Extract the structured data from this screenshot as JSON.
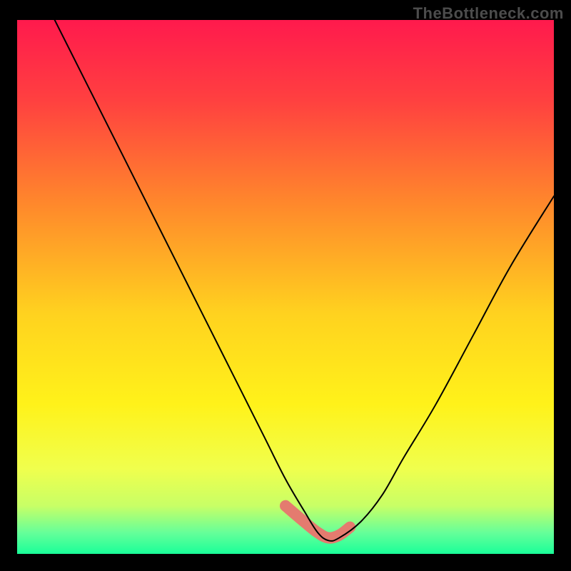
{
  "attribution": "TheBottleneck.com",
  "chart_data": {
    "type": "line",
    "title": "",
    "xlabel": "",
    "ylabel": "",
    "xlim": [
      0,
      100
    ],
    "ylim": [
      0,
      100
    ],
    "series": [
      {
        "name": "bottleneck-curve",
        "x": [
          7,
          10,
          14,
          18,
          22,
          26,
          30,
          34,
          38,
          42,
          46,
          50,
          53.5,
          56,
          58,
          60,
          64,
          68,
          72,
          78,
          85,
          92,
          100
        ],
        "y": [
          100,
          94,
          86,
          78,
          70,
          62,
          54,
          46,
          38,
          30,
          22,
          14,
          8,
          4,
          2.5,
          3,
          6,
          11,
          18,
          28,
          41,
          54,
          67
        ],
        "color": "#000000",
        "width": 2
      }
    ],
    "highlight_segment": {
      "name": "optimal-zone",
      "x": [
        50,
        53.5,
        56,
        58,
        60,
        62
      ],
      "y": [
        9,
        6,
        4,
        3,
        3.5,
        5
      ],
      "color": "#E47B6F",
      "width": 16
    },
    "background_gradient": {
      "type": "vertical",
      "stops": [
        {
          "offset": 0.0,
          "color": "#ff1a4d"
        },
        {
          "offset": 0.15,
          "color": "#ff4040"
        },
        {
          "offset": 0.35,
          "color": "#ff8a2b"
        },
        {
          "offset": 0.55,
          "color": "#ffd21f"
        },
        {
          "offset": 0.72,
          "color": "#fff21a"
        },
        {
          "offset": 0.84,
          "color": "#f0ff4d"
        },
        {
          "offset": 0.91,
          "color": "#c8ff66"
        },
        {
          "offset": 0.96,
          "color": "#66ff99"
        },
        {
          "offset": 1.0,
          "color": "#1aff99"
        }
      ]
    }
  }
}
